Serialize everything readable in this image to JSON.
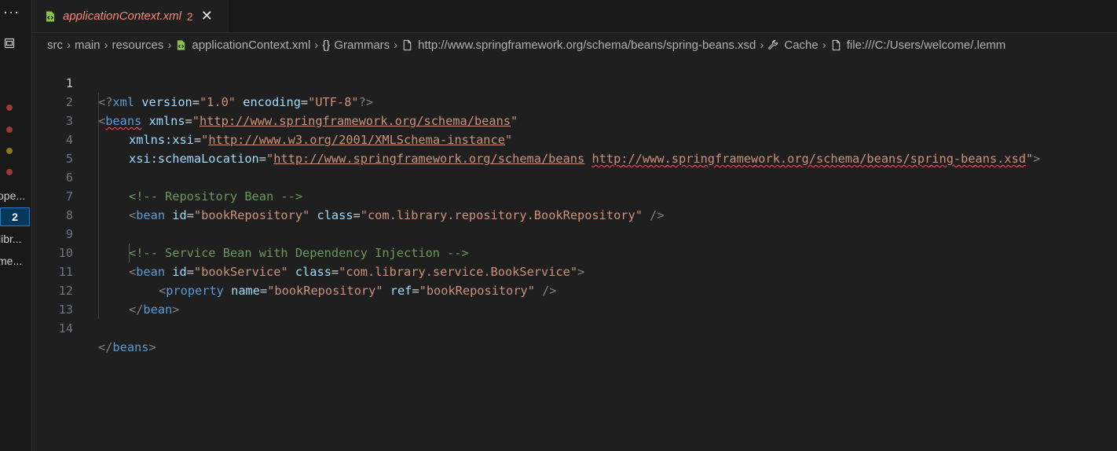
{
  "sidebar": {
    "more": "···",
    "items": [
      {
        "label": "ope..."
      },
      {
        "label": "2"
      },
      {
        "label": "libr..."
      },
      {
        "label": "me..."
      }
    ],
    "dots": [
      "#9c3a3a",
      "#9c3a3a",
      "#8a7a1c",
      "#9c3a3a"
    ]
  },
  "tab": {
    "label": "applicationContext.xml",
    "badge": "2",
    "close": "✕"
  },
  "breadcrumb": {
    "src": "src",
    "main": "main",
    "resources": "resources",
    "file": "applicationContext.xml",
    "grammars": "Grammars",
    "schema": "http://www.springframework.org/schema/beans/spring-beans.xsd",
    "cache": "Cache",
    "cache_file": "file:///C:/Users/welcome/.lemm"
  },
  "editor": {
    "active_line": "1",
    "line_numbers": [
      "1",
      "2",
      "3",
      "4",
      "5",
      "6",
      "7",
      "8",
      "9",
      "10",
      "11",
      "12",
      "13",
      "14"
    ],
    "tokens": {
      "l1_a": "<?",
      "l1_b": "xml",
      "l1_c": " version",
      "l1_d": "=",
      "l1_e": "\"1.0\"",
      "l1_f": " encoding",
      "l1_g": "=",
      "l1_h": "\"UTF-8\"",
      "l1_i": "?>",
      "l2_a": "<",
      "l2_b": "beans",
      "l2_c": " xmlns",
      "l2_d": "=",
      "l2_e1": "\"",
      "l2_e2": "http://www.springframework.org/schema/beans",
      "l2_e3": "\"",
      "l3_a": "xmlns:xsi",
      "l3_b": "=",
      "l3_c1": "\"",
      "l3_c2": "http://www.w3.org/2001/XMLSchema-instance",
      "l3_c3": "\"",
      "l4_a": "xsi:schemaLocation",
      "l4_b": "=",
      "l4_c1": "\"",
      "l4_c2": "http://www.springframework.org/schema/beans",
      "l4_c3": " ",
      "l4_c4": "http://www.springframework.org/schema/beans/spring-beans.xsd",
      "l4_c5": "\"",
      "l4_d": ">",
      "l6": "<!-- Repository Bean -->",
      "l7_a": "<",
      "l7_b": "bean",
      "l7_c": " id",
      "l7_d": "=",
      "l7_e": "\"bookRepository\"",
      "l7_f": " class",
      "l7_g": "=",
      "l7_h": "\"com.library.repository.BookRepository\"",
      "l7_i": " />",
      "l9": "<!-- Service Bean with Dependency Injection -->",
      "l10_a": "<",
      "l10_b": "bean",
      "l10_c": " id",
      "l10_d": "=",
      "l10_e": "\"bookService\"",
      "l10_f": " class",
      "l10_g": "=",
      "l10_h": "\"com.library.service.BookService\"",
      "l10_i": ">",
      "l11_a": "<",
      "l11_b": "property",
      "l11_c": " name",
      "l11_d": "=",
      "l11_e": "\"bookRepository\"",
      "l11_f": " ref",
      "l11_g": "=",
      "l11_h": "\"bookRepository\"",
      "l11_i": " />",
      "l12_a": "</",
      "l12_b": "bean",
      "l12_c": ">",
      "l14_a": "</",
      "l14_b": "beans",
      "l14_c": ">"
    }
  },
  "colors": {
    "background": "#1f1f1f",
    "tag": "#569cd6",
    "attribute": "#9cdcfe",
    "string": "#ce9178",
    "comment": "#6a9955",
    "punctuation": "#808080",
    "error": "#f14c4c",
    "tab_modified": "#f48771"
  }
}
